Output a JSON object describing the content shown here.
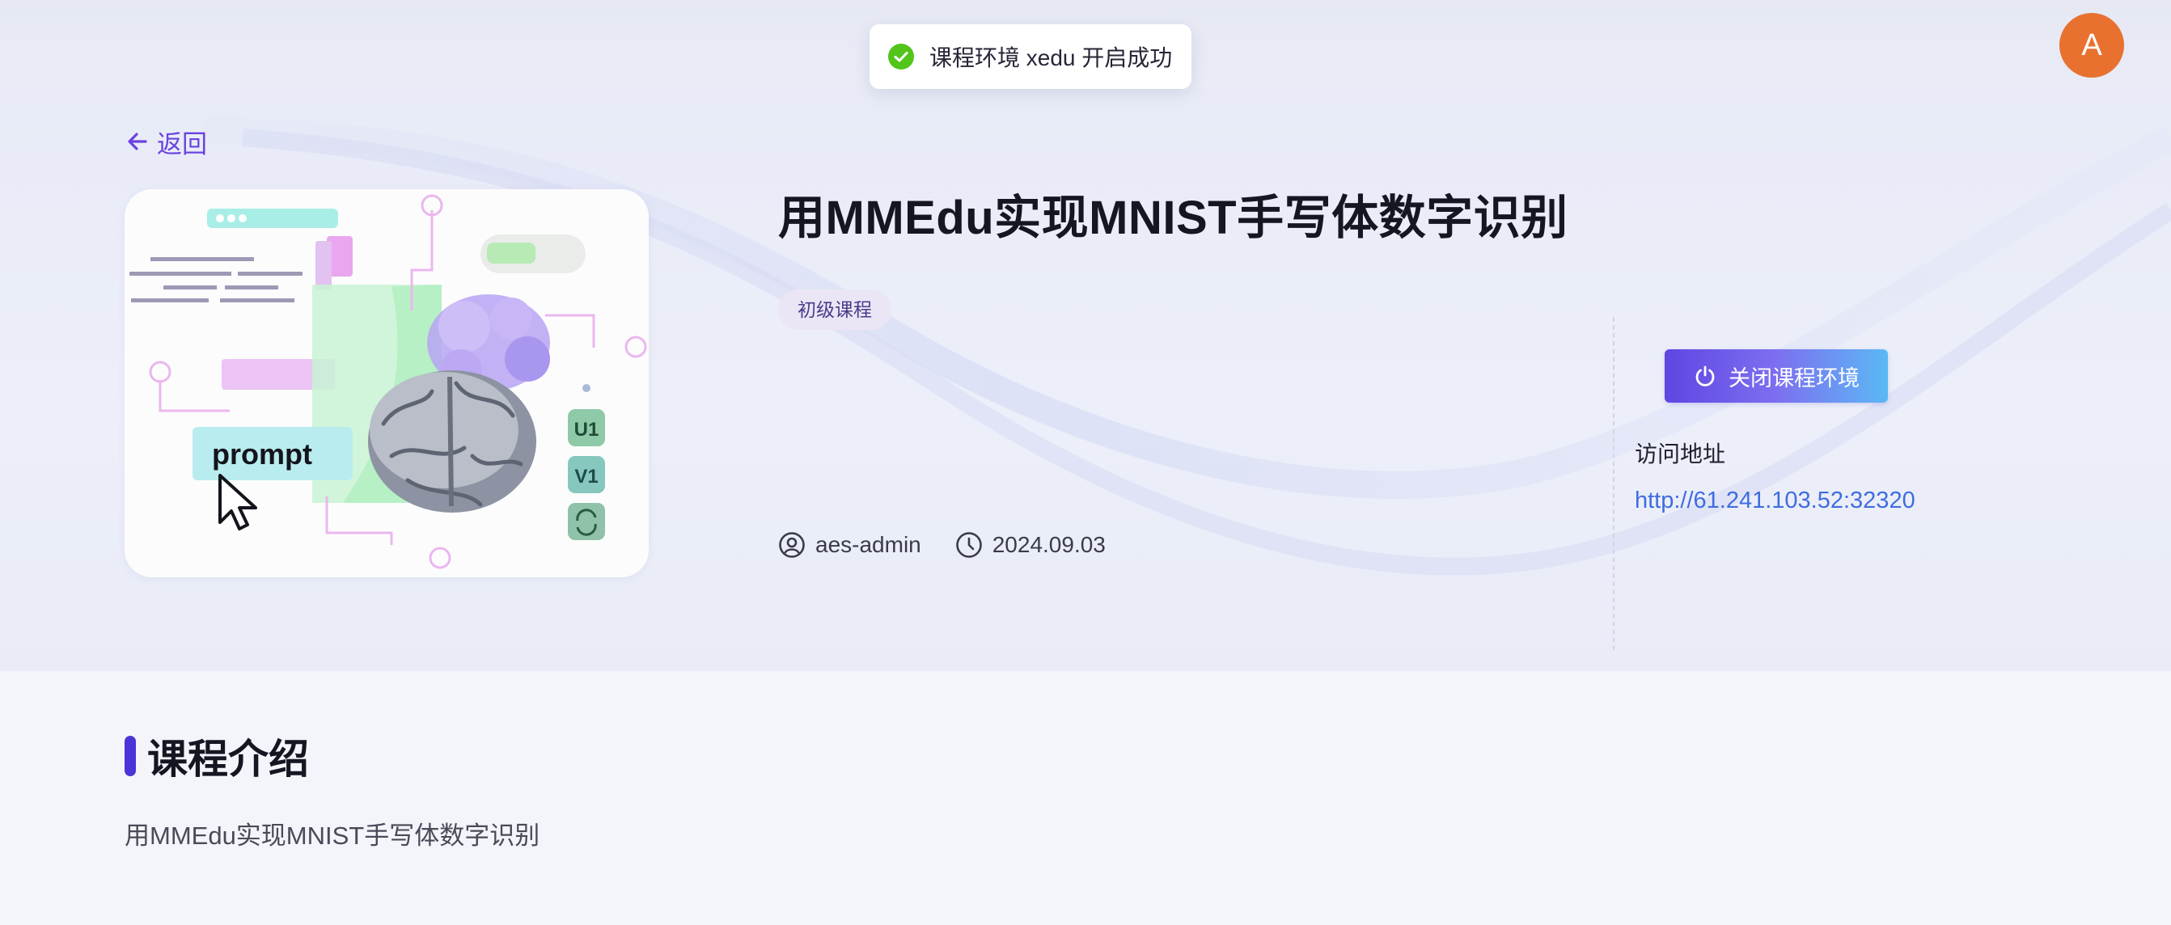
{
  "header": {
    "avatar_letter": "A"
  },
  "toast": {
    "message": "课程环境 xedu 开启成功",
    "icon": "check-circle-icon",
    "color": "#52c41a"
  },
  "hero": {
    "back_label": "返回",
    "title": "用MMEdu实现MNIST手写体数字识别",
    "level_tag": "初级课程",
    "author": "aes-admin",
    "date": "2024.09.03",
    "cover": {
      "prompt_text": "prompt",
      "badges": [
        "U1",
        "V1"
      ]
    }
  },
  "environment": {
    "close_button_label": "关闭课程环境",
    "address_label": "访问地址",
    "address_url": "http://61.241.103.52:32320"
  },
  "intro": {
    "title": "课程介绍",
    "text": "用MMEdu实现MNIST手写体数字识别"
  },
  "colors": {
    "accent": "#6b42e0",
    "avatar": "#e8712f",
    "link": "#3f6de0",
    "intro_bar": "#4a35d8"
  }
}
